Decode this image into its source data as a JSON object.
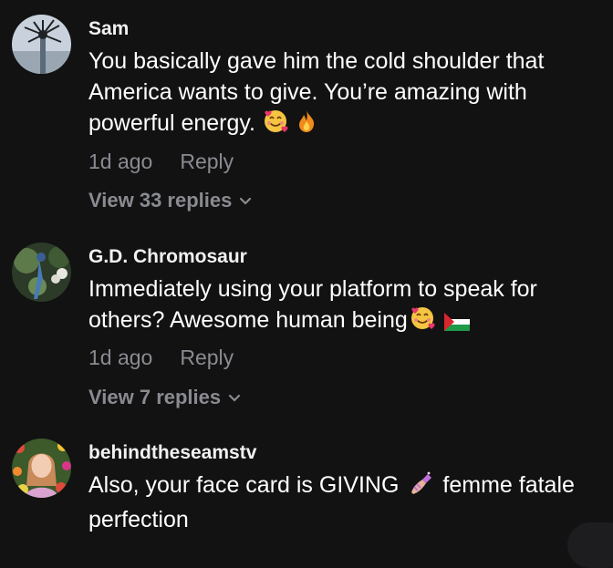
{
  "comments": [
    {
      "username": "Sam",
      "text": "You basically gave him the cold shoulder that America wants to give. You’re amazing with powerful energy.",
      "emojis": [
        "smiling-face-with-hearts-icon",
        "fire-icon"
      ],
      "time": "1d ago",
      "reply_label": "Reply",
      "view_replies": "View 33 replies"
    },
    {
      "username": "G.D. Chromosaur",
      "text": "Immediately using your platform to speak for others? Awesome human being",
      "emojis": [
        "smiling-face-with-hearts-icon",
        "palestine-flag-icon"
      ],
      "time": "1d ago",
      "reply_label": "Reply",
      "view_replies": "View 7 replies"
    },
    {
      "username": "behindtheseamstv",
      "text_before_emoji": "Also, your face card is GIVING",
      "text_after_emoji": "femme fatale perfection",
      "emojis": [
        "nail-polish-icon"
      ]
    }
  ],
  "colors": {
    "background": "#121212",
    "username": "#f1f1f2",
    "text": "#ffffff",
    "secondary": "#8a8b91"
  }
}
